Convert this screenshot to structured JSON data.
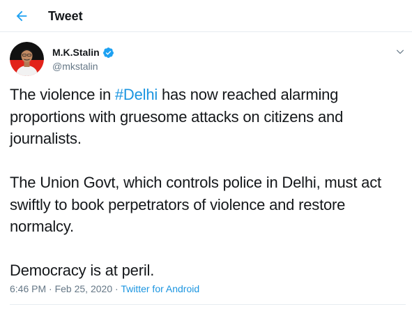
{
  "header": {
    "title": "Tweet",
    "back_icon": "arrow-left-icon"
  },
  "colors": {
    "accent": "#1da1f2",
    "link": "#1b95e0",
    "text_primary": "#14171a",
    "text_secondary": "#657786",
    "divider": "#e6ecf0"
  },
  "author": {
    "display_name": "M.K.Stalin",
    "handle": "@mkstalin",
    "verified_icon": "verified-badge-icon"
  },
  "tweet": {
    "p1_before": "The violence in ",
    "p1_hashtag": "#Delhi",
    "p1_after": " has now reached alarming proportions with gruesome attacks on citizens and journalists.",
    "p2": "The Union Govt, which controls police in Delhi, must act swiftly to book perpetrators of violence and restore normalcy.",
    "p3": "Democracy is at peril."
  },
  "meta": {
    "time": "6:46 PM",
    "separator1": " · ",
    "date": "Feb 25, 2020",
    "separator2": " · ",
    "source": "Twitter for Android"
  }
}
